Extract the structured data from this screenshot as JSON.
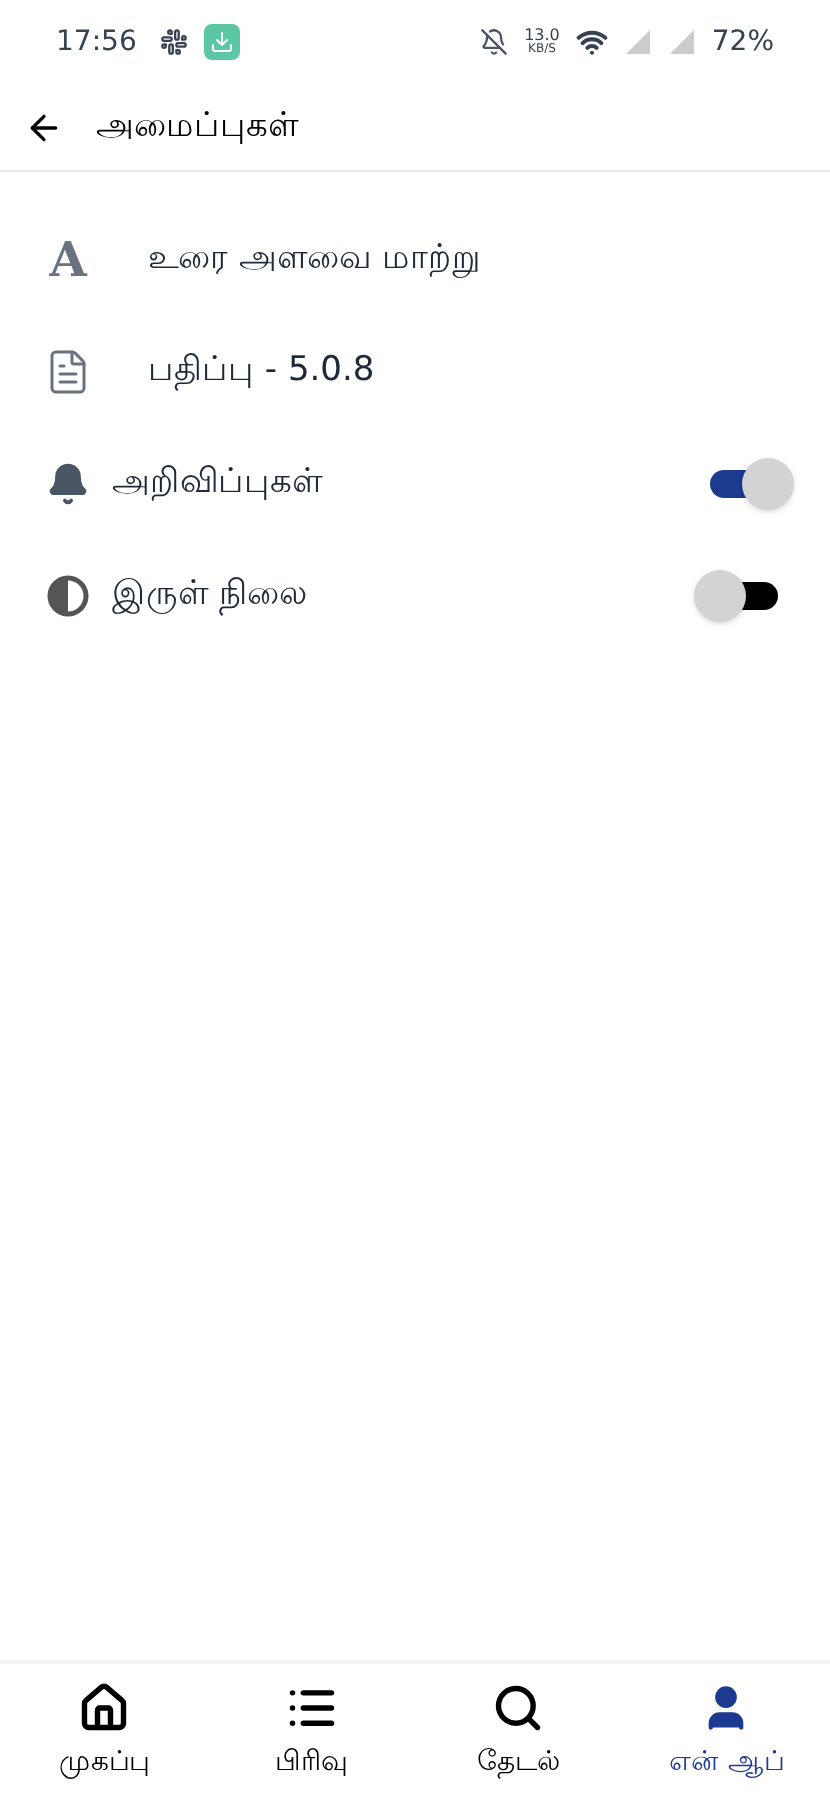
{
  "status_bar": {
    "time": "17:56",
    "speed_value": "13.0",
    "speed_unit": "KB/S",
    "battery": "72%"
  },
  "header": {
    "title": "அமைப்புகள்"
  },
  "settings": [
    {
      "kind": "action",
      "icon_text": "A",
      "label": "உரை அளவை மாற்று"
    },
    {
      "kind": "action",
      "label": "பதிப்பு - 5.0.8"
    },
    {
      "kind": "toggle",
      "label": "அறிவிப்புகள்",
      "on": true
    },
    {
      "kind": "toggle",
      "label": "இருள் நிலை",
      "on": false
    }
  ],
  "bottom_nav": [
    {
      "label": "முகப்பு",
      "selected": false
    },
    {
      "label": "பிரிவு",
      "selected": false
    },
    {
      "label": "தேடல்",
      "selected": false
    },
    {
      "label": "என் ஆப்",
      "selected": true
    }
  ]
}
